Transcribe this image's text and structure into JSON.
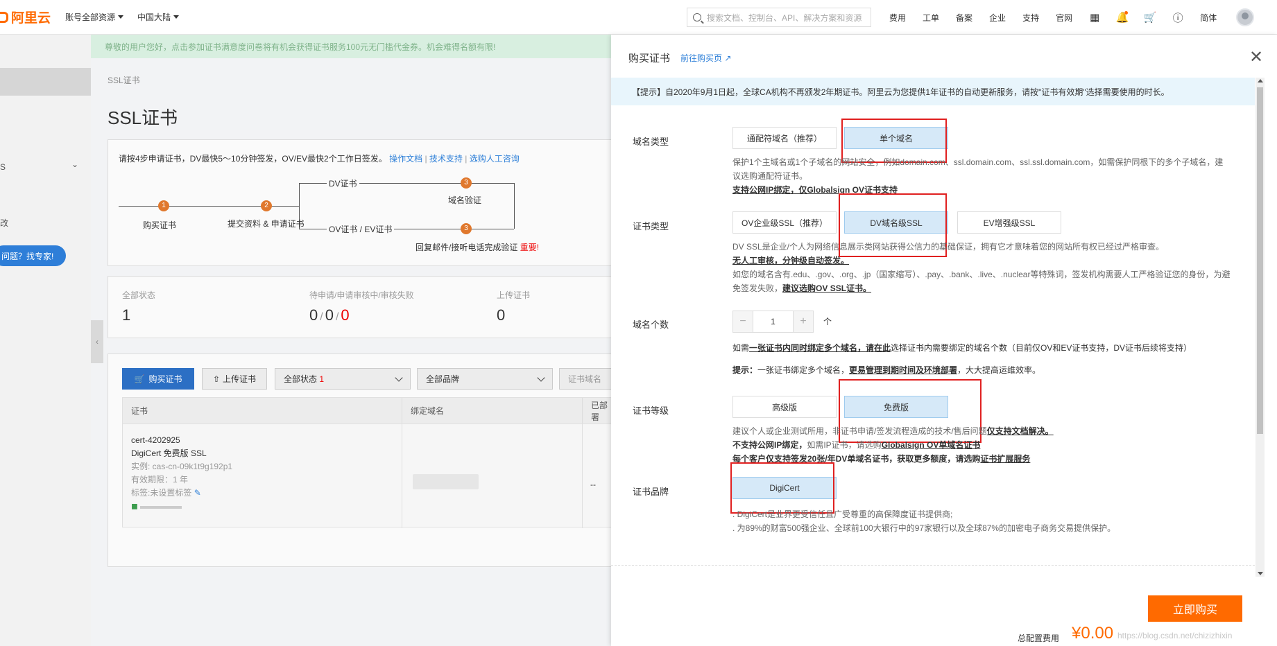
{
  "topbar": {
    "logo_text": "阿里云",
    "menu_account": "账号全部资源",
    "menu_region": "中国大陆",
    "search_placeholder": "搜索文档、控制台、API、解决方案和资源",
    "links": [
      "费用",
      "工单",
      "备案",
      "企业",
      "支持",
      "官网"
    ],
    "lang": "简体"
  },
  "sidebar": {
    "item_s": "S",
    "item_gai": "改",
    "expert_btn": "问题？找专家!"
  },
  "background_page": {
    "banner": "尊敬的用户您好，点击参加证书满意度问卷将有机会获得证书服务100元无门槛代金券。机会难得名额有限!",
    "breadcrumb": "SSL证书",
    "title": "SSL证书",
    "steps_hint": "请按4步申请证书，DV最快5～10分钟签发，OV/EV最快2个工作日签发。",
    "steps_links": [
      "操作文档",
      "技术支持",
      "选购人工咨询"
    ],
    "steps_link_sep": "|",
    "step1": "购买证书",
    "step2": "提交资料 & 申请证书",
    "dv_label": "DV证书",
    "dv_step": "域名验证",
    "ov_label": "OV证书 / EV证书",
    "ov_step": "回复邮件/接听电话完成验证",
    "ov_important": "重要!",
    "step_nums": [
      "1",
      "2",
      "3",
      "3"
    ],
    "stats": {
      "all_label": "全部状态",
      "all_value": "1",
      "pending_label": "待申请/申请审核中/审核失败",
      "pending_values": [
        "0",
        "0",
        "0"
      ],
      "uploaded_label": "上传证书",
      "uploaded_value": "0"
    },
    "toolbar": {
      "buy_btn": "购买证书",
      "upload_btn": "上传证书",
      "status_filter": "全部状态",
      "status_count": "1",
      "brand_filter": "全部品牌",
      "domain_filter": "证书域名"
    },
    "table": {
      "headers": [
        "证书",
        "绑定域名",
        "已部署"
      ],
      "row": {
        "cert_id": "cert-4202925",
        "cert_name": "DigiCert 免费版 SSL",
        "instance": "实例: cas-cn-09k1t9g192p1",
        "validity": "有效期限：1 年",
        "tag": "标签:未设置标签",
        "deployed": "--"
      }
    }
  },
  "drawer": {
    "title": "购买证书",
    "buy_page_link": "前往购买页",
    "tip": "【提示】自2020年9月1日起，全球CA机构不再颁发2年期证书。阿里云为您提供1年证书的自动更新服务，请按\"证书有效期\"选择需要使用的时长。",
    "domain_type": {
      "label": "域名类型",
      "options": [
        "通配符域名（推荐）",
        "单个域名"
      ],
      "selected": "单个域名",
      "desc_line1": "保护1个主域名或1个子域名的网站安全，例如domain.com、ssl.domain.com、ssl.ssl.domain.com，如需保护同根下的多个子域名，建",
      "desc_line2": "议选购通配符证书。",
      "desc_line3": "支持公网IP绑定，仅Globalsign OV证书支持"
    },
    "cert_type": {
      "label": "证书类型",
      "options": [
        "OV企业级SSL（推荐）",
        "DV域名级SSL",
        "EV增强级SSL"
      ],
      "selected": "DV域名级SSL",
      "desc_line1": "DV SSL是企业/个人为网络信息展示类网站获得公信力的基础保证，拥有它才意味着您的网站所有权已经过严格审查。",
      "desc_line2": "无人工审核，分钟级自动签发。",
      "desc_line3": "如您的域名含有.edu、.gov、.org、.jp（国家缩写）、.pay、.bank、.live、.nuclear等特殊词，签发机构需要人工严格验证您的身份，为避",
      "desc_line4a": "免签发失败，",
      "desc_line4b": "建议选购OV SSL证书。"
    },
    "domain_count": {
      "label": "域名个数",
      "minus": "−",
      "value": "1",
      "plus": "+",
      "unit": "个",
      "desc1_a": "如需",
      "desc1_b": "一张证书内同时绑定多个域名，请在此",
      "desc1_c": "选择证书内需要绑定的域名个数（目前仅OV和EV证书支持，DV证书后续将支持）",
      "desc2_a": "提示：",
      "desc2_b": "一张证书绑定多个域名，",
      "desc2_c": "更易管理到期时间及环境部署",
      "desc2_d": "，大大提高运维效率。"
    },
    "cert_level": {
      "label": "证书等级",
      "options": [
        "高级版",
        "免费版"
      ],
      "selected": "免费版",
      "desc1_a": "建议个人或企业测试所用，非证书申请/签发流程造成的技术/售后问题",
      "desc1_b": "仅支持文档解决。",
      "desc2_a": "不支持公网IP绑定，",
      "desc2_b": "如需IP证书，请选购",
      "desc2_c": "Globalsign OV单域名证书",
      "desc3_a": "每个客户仅支持签发20张/年DV单域名证书，获取更多额度，请选购",
      "desc3_b": "证书扩展服务"
    },
    "brand": {
      "label": "证书品牌",
      "options": [
        "DigiCert"
      ],
      "selected": "DigiCert",
      "desc1": ". DigiCert是业界更受信任且广受尊重的高保障度证书提供商;",
      "desc2": ". 为89%的财富500强企业、全球前100大银行中的97家银行以及全球87%的加密电子商务交易提供保护。"
    },
    "footer": {
      "buy_now": "立即购买",
      "cost_label": "总配置费用",
      "cost_value": "¥0.00",
      "watermark": "https://blog.csdn.net/chizizhixin"
    }
  },
  "colors": {
    "brand_orange": "#ff6a00",
    "link_blue": "#2f80d8",
    "highlight_red": "#e02020",
    "selected_bg": "#d6e9f8"
  }
}
